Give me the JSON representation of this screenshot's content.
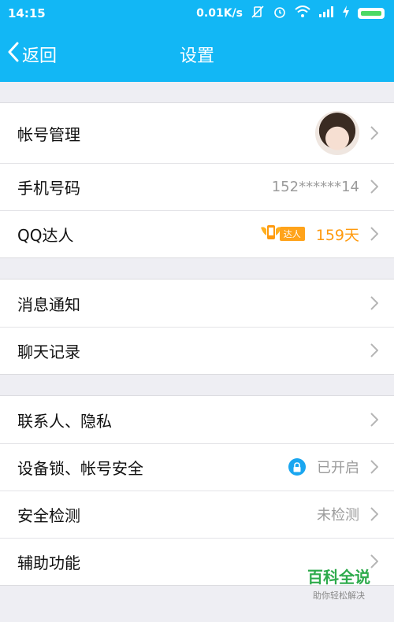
{
  "status_bar": {
    "time": "14:15",
    "speed": "0.01K/s"
  },
  "nav": {
    "back_label": "返回",
    "title": "设置"
  },
  "groups": [
    {
      "rows": [
        {
          "label": "帐号管理"
        },
        {
          "label": "手机号码",
          "value": "152******14"
        },
        {
          "label": "QQ达人",
          "badge_text": "达人",
          "value": "159天"
        }
      ]
    },
    {
      "rows": [
        {
          "label": "消息通知"
        },
        {
          "label": "聊天记录"
        }
      ]
    },
    {
      "rows": [
        {
          "label": "联系人、隐私"
        },
        {
          "label": "设备锁、帐号安全",
          "value": "已开启"
        },
        {
          "label": "安全检测",
          "value": "未检测"
        },
        {
          "label": "辅助功能"
        }
      ]
    }
  ],
  "watermark": {
    "main": "百科全说",
    "sub": "助你轻松解决"
  },
  "colors": {
    "primary": "#12b7f5",
    "orange": "#ff9a0e",
    "lock": "#1aa6f0"
  }
}
